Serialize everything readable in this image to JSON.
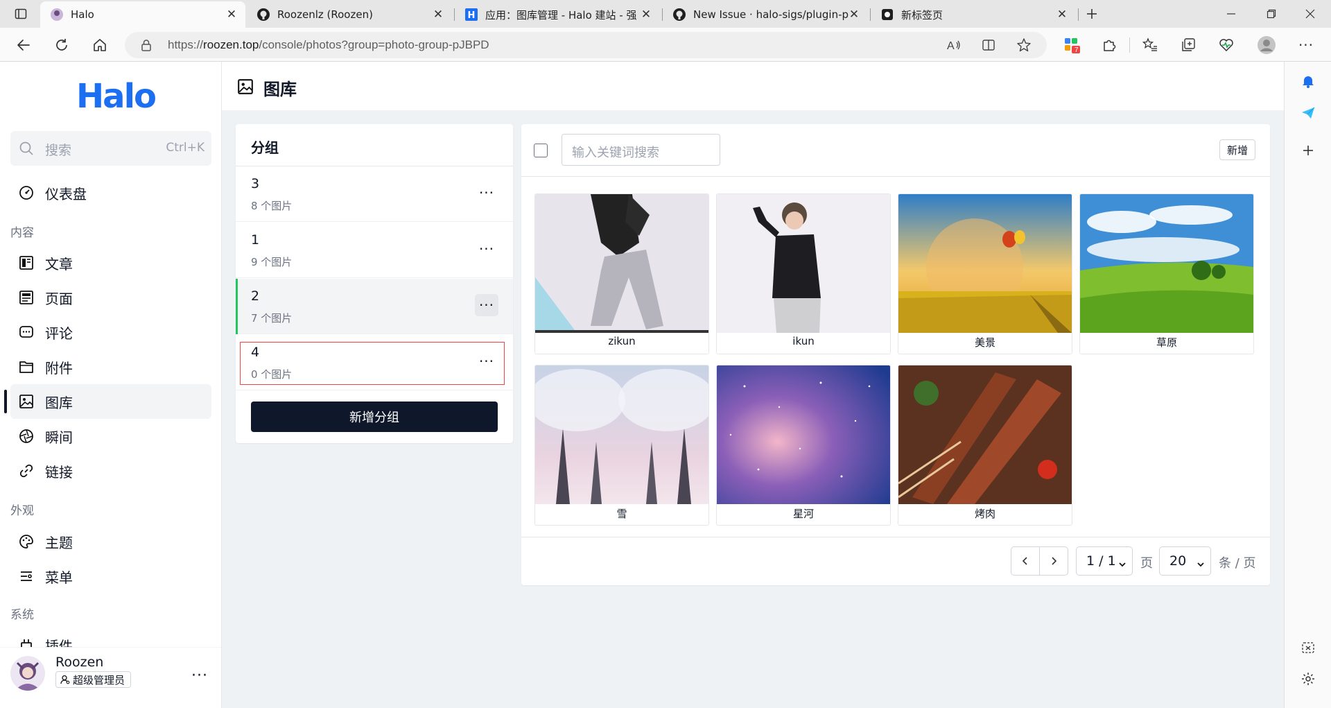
{
  "browser": {
    "tabs": [
      {
        "title": "Halo",
        "active": true
      },
      {
        "title": "Roozenlz (Roozen)",
        "active": false
      },
      {
        "title": "应用：图库管理 - Halo 建站 - 强",
        "active": false
      },
      {
        "title": "New Issue · halo-sigs/plugin-pho",
        "active": false
      },
      {
        "title": "新标签页",
        "active": false
      }
    ],
    "url_prefix": "https://",
    "url_host": "roozen.top",
    "url_path": "/console/photos?group=photo-group-pJBPD",
    "extension_badge": "7"
  },
  "sidebar": {
    "logo": "Halo",
    "search_placeholder": "搜索",
    "search_shortcut": "Ctrl+K",
    "items": [
      {
        "label": "仪表盘",
        "icon": "dashboard-icon"
      },
      {
        "label": "文章",
        "icon": "article-icon"
      },
      {
        "label": "页面",
        "icon": "page-icon"
      },
      {
        "label": "评论",
        "icon": "comment-icon"
      },
      {
        "label": "附件",
        "icon": "folder-icon"
      },
      {
        "label": "图库",
        "icon": "image-icon",
        "active": true
      },
      {
        "label": "瞬间",
        "icon": "aperture-icon"
      },
      {
        "label": "链接",
        "icon": "link-icon"
      },
      {
        "label": "主题",
        "icon": "palette-icon"
      },
      {
        "label": "菜单",
        "icon": "menu-icon"
      },
      {
        "label": "插件",
        "icon": "plugin-icon"
      }
    ],
    "sections": [
      "内容",
      "外观",
      "系统"
    ],
    "user": {
      "name": "Roozen",
      "role": "超级管理员",
      "more": "···"
    }
  },
  "header": {
    "title": "图库"
  },
  "groups": {
    "title": "分组",
    "items": [
      {
        "name": "3",
        "count": "8 个图片"
      },
      {
        "name": "1",
        "count": "9 个图片"
      },
      {
        "name": "2",
        "count": "7 个图片",
        "active": true
      },
      {
        "name": "4",
        "count": "0 个图片",
        "selected": true
      }
    ],
    "more": "···",
    "add_label": "新增分组"
  },
  "photos": {
    "search_placeholder": "输入关键词搜索",
    "new_label": "新增",
    "items": [
      {
        "caption": "zikun"
      },
      {
        "caption": "ikun"
      },
      {
        "caption": "美景"
      },
      {
        "caption": "草原"
      },
      {
        "caption": "雪"
      },
      {
        "caption": "星河"
      },
      {
        "caption": "烤肉"
      }
    ],
    "pagination": {
      "page": "1 / 1",
      "page_unit": "页",
      "size": "20",
      "size_unit": "条 / 页"
    }
  },
  "colors": {
    "brand": "#1d6ff2",
    "accent_dark": "#0f172a",
    "active_bar": "#22c55e",
    "selected_border": "#ef4444"
  }
}
